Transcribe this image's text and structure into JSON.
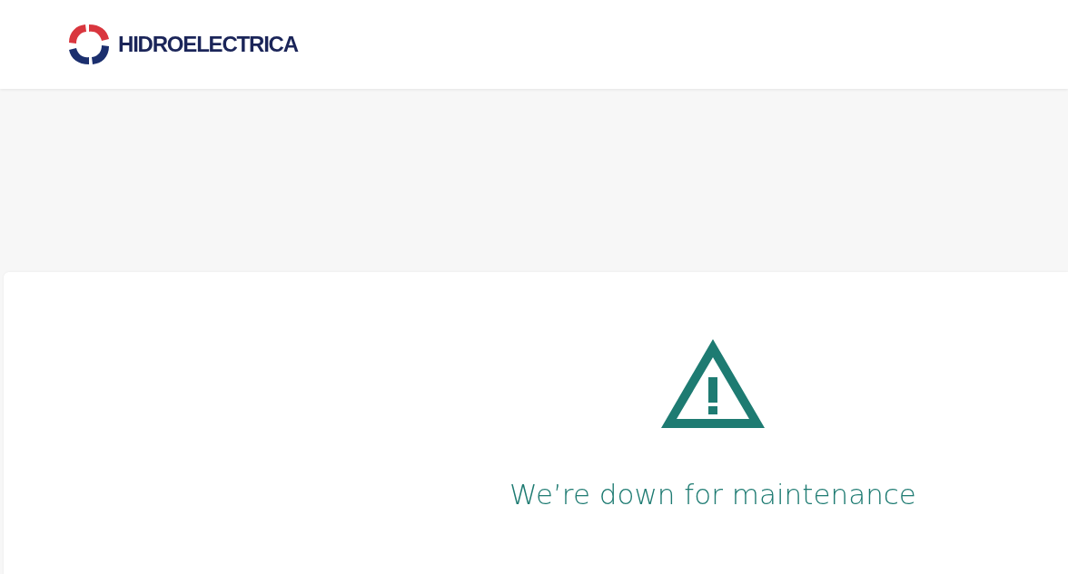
{
  "header": {
    "logo_text": "HIDROELECTRICA"
  },
  "message": {
    "title": "We’re down for maintenance"
  }
}
